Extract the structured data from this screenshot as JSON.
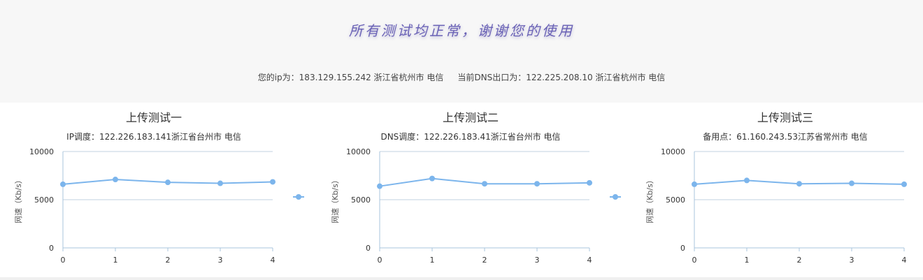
{
  "header": {
    "headline": "所有测试均正常，谢谢您的使用",
    "ip_info": "您的ip为：183.129.155.242 浙江省杭州市 电信",
    "dns_info": "当前DNS出口为：122.225.208.10 浙江省杭州市 电信"
  },
  "colors": {
    "series": "#7cb5ec",
    "grid": "#c0d0e0",
    "axis": "#a8c4dc"
  },
  "panels": [
    {
      "title": "上传测试一",
      "subtitle": "IP调度：122.226.183.141浙江省台州市 电信",
      "ylabel": "网速（Kb/s）"
    },
    {
      "title": "上传测试二",
      "subtitle": "DNS调度：122.226.183.41浙江省台州市 电信",
      "ylabel": "网速（Kb/s）"
    },
    {
      "title": "上传测试三",
      "subtitle": "备用点：61.160.243.53江苏省常州市 电信",
      "ylabel": "网速（Kb/s）"
    }
  ],
  "chart_data": [
    {
      "type": "line",
      "x": [
        0,
        1,
        2,
        3,
        4
      ],
      "values": [
        6600,
        7100,
        6800,
        6700,
        6850
      ],
      "ylim": [
        0,
        10000
      ],
      "yticks": [
        0,
        5000,
        10000
      ],
      "grid": true,
      "legend": "right"
    },
    {
      "type": "line",
      "x": [
        0,
        1,
        2,
        3,
        4
      ],
      "values": [
        6400,
        7200,
        6650,
        6650,
        6750
      ],
      "ylim": [
        0,
        10000
      ],
      "yticks": [
        0,
        5000,
        10000
      ],
      "grid": true,
      "legend": "right"
    },
    {
      "type": "line",
      "x": [
        0,
        1,
        2,
        3,
        4
      ],
      "values": [
        6600,
        7000,
        6650,
        6700,
        6600
      ],
      "ylim": [
        0,
        10000
      ],
      "yticks": [
        0,
        5000,
        10000
      ],
      "grid": true,
      "legend": "none"
    }
  ]
}
